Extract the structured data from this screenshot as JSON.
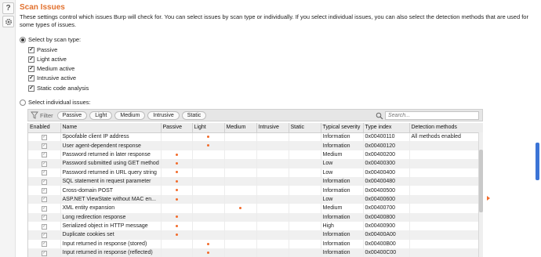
{
  "page": {
    "title": "Scan Issues",
    "description": "These settings control which issues Burp will check for. You can select issues by scan type or individually. If you select individual issues, you can also select the detection methods that are used for some types of issues."
  },
  "scan_type": {
    "radio_label": "Select by scan type:",
    "selected": true,
    "options": [
      {
        "label": "Passive",
        "checked": true
      },
      {
        "label": "Light active",
        "checked": true
      },
      {
        "label": "Medium active",
        "checked": true
      },
      {
        "label": "Intrusive active",
        "checked": true
      },
      {
        "label": "Static code analysis",
        "checked": true
      }
    ]
  },
  "individual": {
    "radio_label": "Select individual issues:",
    "selected": false
  },
  "filter": {
    "label": "Filter",
    "buttons": [
      "Passive",
      "Light",
      "Medium",
      "Intrusive",
      "Static"
    ],
    "search_placeholder": "Search..."
  },
  "table": {
    "columns": [
      "Enabled",
      "Name",
      "Passive",
      "Light",
      "Medium",
      "Intrusive",
      "Static",
      "Typical severity",
      "Type index",
      "Detection methods"
    ],
    "rows": [
      {
        "name": "Spoofable client IP address",
        "passive": false,
        "light": true,
        "medium": false,
        "intrusive": false,
        "static": false,
        "severity": "Information",
        "type_index": "0x00400110",
        "methods": "All methods enabled"
      },
      {
        "name": "User agent-dependent response",
        "passive": false,
        "light": true,
        "medium": false,
        "intrusive": false,
        "static": false,
        "severity": "Information",
        "type_index": "0x00400120",
        "methods": ""
      },
      {
        "name": "Password returned in later response",
        "passive": true,
        "light": false,
        "medium": false,
        "intrusive": false,
        "static": false,
        "severity": "Medium",
        "type_index": "0x00400200",
        "methods": ""
      },
      {
        "name": "Password submitted using GET method",
        "passive": true,
        "light": false,
        "medium": false,
        "intrusive": false,
        "static": false,
        "severity": "Low",
        "type_index": "0x00400300",
        "methods": ""
      },
      {
        "name": "Password returned in URL query string",
        "passive": true,
        "light": false,
        "medium": false,
        "intrusive": false,
        "static": false,
        "severity": "Low",
        "type_index": "0x00400400",
        "methods": ""
      },
      {
        "name": "SQL statement in request parameter",
        "passive": true,
        "light": false,
        "medium": false,
        "intrusive": false,
        "static": false,
        "severity": "Information",
        "type_index": "0x00400480",
        "methods": ""
      },
      {
        "name": "Cross-domain POST",
        "passive": true,
        "light": false,
        "medium": false,
        "intrusive": false,
        "static": false,
        "severity": "Information",
        "type_index": "0x00400500",
        "methods": ""
      },
      {
        "name": "ASP.NET ViewState without MAC en...",
        "passive": true,
        "light": false,
        "medium": false,
        "intrusive": false,
        "static": false,
        "severity": "Low",
        "type_index": "0x00400600",
        "methods": ""
      },
      {
        "name": "XML entity expansion",
        "passive": false,
        "light": false,
        "medium": true,
        "intrusive": false,
        "static": false,
        "severity": "Medium",
        "type_index": "0x00400700",
        "methods": ""
      },
      {
        "name": "Long redirection response",
        "passive": true,
        "light": false,
        "medium": false,
        "intrusive": false,
        "static": false,
        "severity": "Information",
        "type_index": "0x00400800",
        "methods": ""
      },
      {
        "name": "Serialized object in HTTP message",
        "passive": true,
        "light": false,
        "medium": false,
        "intrusive": false,
        "static": false,
        "severity": "High",
        "type_index": "0x00400900",
        "methods": ""
      },
      {
        "name": "Duplicate cookies set",
        "passive": true,
        "light": false,
        "medium": false,
        "intrusive": false,
        "static": false,
        "severity": "Information",
        "type_index": "0x00400A00",
        "methods": ""
      },
      {
        "name": "Input returned in response (stored)",
        "passive": false,
        "light": true,
        "medium": false,
        "intrusive": false,
        "static": false,
        "severity": "Information",
        "type_index": "0x00400B00",
        "methods": ""
      },
      {
        "name": "Input returned in response (reflected)",
        "passive": false,
        "light": true,
        "medium": false,
        "intrusive": false,
        "static": false,
        "severity": "Information",
        "type_index": "0x00400C00",
        "methods": ""
      }
    ]
  },
  "icons": {
    "help": "help-icon",
    "settings": "gear-icon",
    "filter": "funnel-icon",
    "search": "magnifier-icon"
  },
  "colors": {
    "title": "#e2712e",
    "dot": "#f26b2b",
    "accent": "#3b74d6"
  }
}
